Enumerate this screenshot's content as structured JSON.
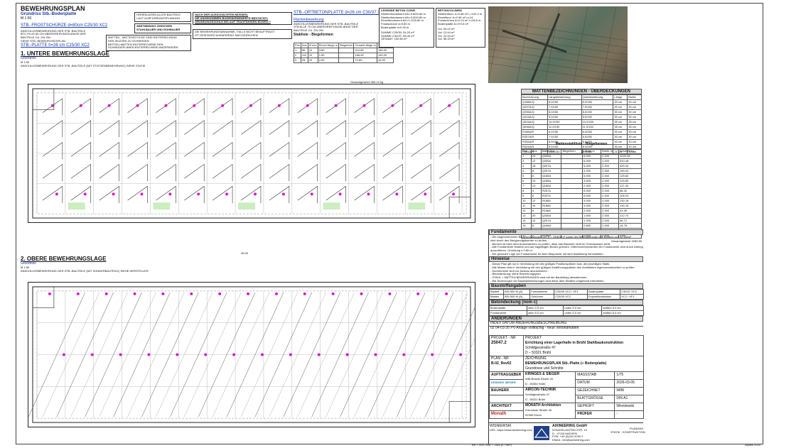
{
  "header": {
    "title": "BEWEHRUNGSPLAN",
    "subtitle": "Grundriss Stb.-Bodenplatte",
    "scale": "M 1:50",
    "frost_line": "STB.-FROSTSCHÜRZE d=80cm C25/30 XC2",
    "frost_note_1": "ANSCHLUSSBEWEHRUNG DER STB.-BAUTEILE",
    "frost_note_2": "BTC-PLUS 50 CM ÜBERGREIFUNGSLÄNGE DER",
    "frost_note_3": "BAUTEILE CA. 20x 20x",
    "frost_note_4": "SIEHE STB.-BEWEHRUNGSPLAN",
    "plate_line": "STB.-PLATTE h=26 cm C25/30 XC2"
  },
  "notes": {
    "heights_1": "HÖHENLAGEN ALLER BAUTEILE",
    "heights_2": "LAUT AUSFÜHRUNGSPLANUNG",
    "coord_1": "ABSTIMMUNG ZWISCHEN",
    "coord_2": "STAHLBAUER UND ROHBAUER",
    "mats_1": "MATTEN - MATTENSTÜCKE SIND ENTSPRECHEND",
    "mats_2": "DEN SKIZZEN ZU SCHNEIDEN",
    "mats_3": "BESTELLMATTEN ENTSPRECHEND DEN",
    "mats_4": "SCHNEIDEPLÄNEN ENTSPRECHEND ANZEPASSEN",
    "soil_1": "NACH DER AUSSCHACHTEN MÜSSEN,",
    "soil_2": "DIE ANGENOMMEN BODENKENNWERTE BESTÄTIGT,",
    "soil_3": "GRÜNDUNGSSOHLE BIS AUF TRAGFÄHIGEN BODEN !!",
    "assume_1": "DIE BEWEHRUNGSANNAHME, FALLS NICHT BEAUFTRAGT",
    "assume_2": "IST DEM BÜRO AIXINEERING NACHZURICHEN"
  },
  "ortbeton": {
    "title": "STB.-ORTBETONPLATTE d=26 cm C30/37 XC2",
    "sub_title": "Flächenbewehrung",
    "sub_1": "ANSCHLUSSBEWEHRUNG DER STB.-BAUTEILE",
    "sub_2": "STB ALLE 75 CM ÜBERGREIFUNGSLÄNGE DER",
    "sub_3": "BAUTEILE CA. 20x 20x",
    "list_title": "Stabliste - Biegeformen",
    "headers": [
      "Pos",
      "Anz",
      "Ø mm",
      "Einzel-länge m",
      "Biegeform",
      "Gesamt-länge m",
      "Gewicht kg"
    ],
    "rows": [
      [
        "1",
        "56",
        "12",
        "3.80",
        "",
        "212.80",
        "189.00"
      ],
      [
        "2",
        "112",
        "12",
        "1.50",
        "",
        "168.00",
        "149.20"
      ],
      [
        "3",
        "28",
        "10",
        "2.60",
        "",
        "72.80",
        "44.90"
      ]
    ],
    "sum_label": "Gesamtgewicht",
    "sum_value": "383.10 kg"
  },
  "legend_concrete": {
    "title": "LEGENDE BETON C25/30",
    "lines": [
      "Streifenfundament b/h=0.60/0.80 m",
      "Streifenfundament b/h=0.50/0.80 m",
      "Einzelfundament b/h=1.20/0.80 m",
      "Frostschürze d=0.80 m",
      "Bodenplatte d=0.26 m"
    ],
    "sums": [
      "SUMME C25/30: 54.20 m³",
      "SUMME C30/37: 96.40 m³",
      "GESAMT: 150.60 m³"
    ]
  },
  "legend_volume": {
    "title": "BETONVOLUMEN",
    "lines": [
      "Streifenfund. A=0.48 m² L=104.2 m",
      "Einzelfund. A=0.96 m² n=14",
      "Frostschürze A=0.24 m² L=95.6 m",
      "Bodenplatte A=370.5 m²"
    ],
    "sums": [
      "Vol. 50.02 m³",
      "Vol. 13.44 m³",
      "Vol. 22.94 m³",
      "Vol. 96.33 m³"
    ]
  },
  "plan1": {
    "title": "1. UNTERE BEWEHRUNGSLAGE",
    "sub": "Grundriss",
    "scale": "M 1:50",
    "note": "ANSCHLUSSBEWEHRUNG DER STB.-BAUTEILE (MIT STÜTZENBEWEHRUNG) SIEHE STATIK"
  },
  "plan2": {
    "title": "2. OBERE BEWEHRUNGSLAGE",
    "sub": "Grundriss",
    "scale": "M 1:50",
    "note": "ANSCHLUSSBEWEHRUNG DER STB.-BAUTEILE (MIT SONDERBAUTEILE) SIEHE HERSTELLER"
  },
  "dimension_total": "45.00",
  "mats_table": {
    "title": "MATTENBEZEICHNUNGEN - ÜBERDECKUNGEN",
    "headers": [
      "Bezeichnung",
      "Längsbewehrung",
      "Querbewehrung",
      "Länge",
      "Breite"
    ],
    "rows": [
      [
        "Q188A/Q",
        "6.0/150",
        "6.0/150",
        "30 cm",
        "30 cm"
      ],
      [
        "Q257A/Q",
        "7.0/150",
        "7.0/150",
        "30 cm",
        "30 cm"
      ],
      [
        "Q335A/Q",
        "8.0/150",
        "8.0/150",
        "30 cm",
        "30 cm"
      ],
      [
        "Q424A/Q",
        "9.0/150",
        "9.0/150",
        "30 cm",
        "30 cm"
      ],
      [
        "Q524A/Q",
        "10.0/150",
        "10.0/150",
        "35 cm",
        "35 cm"
      ],
      [
        "Q636A/Q",
        "11.0/150",
        "11.0/150",
        "35 cm",
        "35 cm"
      ],
      [
        "R188A/R",
        "6.0/150",
        "6.0/250",
        "30 cm",
        "30 cm"
      ],
      [
        "R257A/R",
        "7.0/150",
        "6.0/250",
        "30 cm",
        "30 cm"
      ],
      [
        "R335A/R",
        "8.0/150",
        "6.0/250",
        "30 cm",
        "30 cm"
      ],
      [
        "R424A/R",
        "9.0/150",
        "8.0/250",
        "30 cm",
        "30 cm"
      ],
      [
        "R524A/R",
        "10.0/150",
        "8.0/250",
        "35 cm",
        "35 cm"
      ]
    ]
  },
  "steel_table": {
    "title": "Mattenstahlliste - Biegeformen",
    "headers": [
      "Pos",
      "Anz",
      "Mattentyp",
      "Biegeform",
      "Länge m",
      "Breite m",
      "Gewicht kg"
    ],
    "rows": [
      [
        "1",
        "24",
        "Q335A",
        "",
        "6.000",
        "2.300",
        "1020.96"
      ],
      [
        "2",
        "12",
        "Q335A",
        "",
        "6.000",
        "2.300",
        "510.48"
      ],
      [
        "3",
        "18",
        "Q257A",
        "",
        "5.000",
        "2.300",
        "425.34"
      ],
      [
        "4",
        "8",
        "Q257A",
        "",
        "4.200",
        "2.300",
        "159.04"
      ],
      [
        "5",
        "6",
        "Q188A",
        "",
        "6.000",
        "2.300",
        "125.82"
      ],
      [
        "6",
        "10",
        "Q188A",
        "",
        "3.600",
        "2.300",
        "125.82"
      ],
      [
        "7",
        "14",
        "Q188A",
        "",
        "2.400",
        "2.300",
        "117.43"
      ],
      [
        "8",
        "4",
        "R257A",
        "",
        "6.000",
        "2.300",
        "86.42"
      ],
      [
        "9",
        "6",
        "R257A",
        "",
        "5.000",
        "2.300",
        "108.03"
      ],
      [
        "10",
        "12",
        "R188A",
        "",
        "4.000",
        "2.300",
        "130.18"
      ],
      [
        "11",
        "16",
        "R188A",
        "",
        "3.000",
        "2.300",
        "130.18"
      ],
      [
        "12",
        "8",
        "R188A",
        "",
        "2.000",
        "2.300",
        "43.39"
      ],
      [
        "13",
        "20",
        "Q335A",
        "",
        "1.500",
        "2.300",
        "212.70"
      ],
      [
        "14",
        "10",
        "Q257A",
        "",
        "1.200",
        "2.300",
        "56.71"
      ],
      [
        "15",
        "6",
        "Q188A",
        "",
        "0.800",
        "2.300",
        "16.78"
      ],
      [
        "16",
        "4",
        "R188A",
        "",
        "0.600",
        "2.300",
        "8.68"
      ],
      [
        "17",
        "2",
        "R188A",
        "",
        "0.400",
        "2.300",
        "2.89"
      ]
    ],
    "sum_label": "Gesamtgewicht",
    "sum_value": "3280.85"
  },
  "fundamente": {
    "title": "Fundamente",
    "lines": [
      "- Die angenommenen Bodenpressungen von σ = 150kN/m² sowie der Bettungsmodul des Bodens von 30 kN/m³",
      "  sind durch den Baugrundgutachter zu prüfen.",
      "- Bereich ist nach dem Ausschachten zu prüfen, dass das Bauwerk nicht im Grundwasser steht.",
      "- Alle Fundamente frostfrei und auf tragfähigen Boden gründen. Differenzhöhenstufen der Fundamente sind durch Abtreppungen < 30°",
      "  auszuführen. Gründung ≥ 0.80 m.",
      "- Die genauen Lage der Fundamente ist nach Absprache mit dem Bauleitung herzustellen."
    ]
  },
  "hinweise": {
    "title": "Hinweise",
    "lines": [
      "- Dieser Plan gilt nur in Verbindung mit den gültigen Positionsplänen bzw. den jeweiligen Statik.",
      "- Alle Masse sind in Verbindung mit den gültigen Ausführungsplänen des Architekten eigenverantwortlich zu prüfen.",
      "- Durchbrüche sind vor Ausbau abzustimmen.",
      "- Betondeckung: siehe Bewehrungsplan.",
      "- STAHL = MATTEN BEWEHRUNGEN sind mit der Bauleitung abzustimmen.",
      "- Bei Änderungen der Bauteilabmessungen sind diese dem Statiker umgehend mitzuteilen."
    ]
  },
  "baustoffe": {
    "title": "Baustoffangaben",
    "row1": [
      "Bauteil",
      "BSt 500 M (A)",
      "Fundamente",
      "C25/30 XC2 / XF1",
      "Bodenplatte",
      "C30/37 XC2"
    ],
    "row2": [
      "Matten",
      "BSt 500 M (A)",
      "Schürzen",
      "C25/30 XC2",
      "Expositionsklasse",
      "XC2 / XF1"
    ]
  },
  "betondeckung": {
    "title": "Betondeckung (nom c)",
    "row1": [
      "Bodenplatte",
      "oben 2.5 cm",
      "unten 5.0 cm",
      "seitlich 5.0 cm"
    ],
    "row2": [
      "Fundamente",
      "oben 5.0 cm",
      "unten 5.0 cm",
      "seitlich 5.0 cm"
    ]
  },
  "aenderungen": {
    "title": "ÄNDERUNGEN",
    "header": "INDEX  DATUM  ÄNDERUNGSBESCHREIBUNG",
    "rows": [
      {
        "index": "02",
        "date": "04-03-26",
        "text": "PV-Anlage vollflächig - neue Verbindmatten"
      }
    ]
  },
  "titleblock": {
    "project_label": "PROJEKT - NR",
    "project_nr": "25047.2",
    "project_head": "PROJEKT",
    "project_name": "Errichtung einer Lagerhalle in Brühl Stahlbaukonstruktion",
    "project_street": "Schildgesstraße 47",
    "project_city": "D – 50321 Brühl",
    "plan_label": "PLAN - NR",
    "plan_nr": "B-02_Rev02",
    "drawing_head": "ZEICHNUNG",
    "drawing_name": "BEWEHRUNGSPLAN Stb.-Platte (+ Bodenplatte)",
    "drawing_sub": "Grundrisse und Schnitte",
    "client_label": "AUFTRAGGEBER",
    "client_name": "KRINGES & SIEGER",
    "client_addr1": "Willi-Brandt-Straße 20",
    "client_addr2": "D - 50354 Hürth",
    "builder_label": "BAUHERR",
    "builder_name": "AIRCON-TECHNIK",
    "builder_addr1": "Schildgesstraße 47",
    "builder_addr2": "D - 50321 Brühl",
    "arch_label": "ARCHITEKT",
    "arch_name": "MONATH Architekten",
    "arch_addr1": "Kreuzauer Straße 46",
    "arch_addr2": "52355 Düren",
    "scale_label": "MASSSTAB",
    "scale_val": "1/75",
    "date_label": "DATUM",
    "date_val": "2026-03-05",
    "drawn_label": "GEZEICHNET",
    "drawn_val": "WIBI",
    "size_label": "BLATTGRÖSSE",
    "size_val": "DIN A1",
    "checked_label": "GEPRÜFT",
    "checked_val": "Wisniewski",
    "examiner_label": "PRÜFER",
    "examiner_val": "-",
    "logo_client": "KRINGES SIEGER",
    "logo_monath": "Monath",
    "signature_name": "WISNIEWSKI",
    "signature_sub": "URL: https://www.aixineering.com",
    "company": "AIXINEERING",
    "company_suffix": "GmbH",
    "company_addr1": "KÖNIGIN-ASTRID-STR. 19",
    "company_addr2": "D - 47119 AACHEN",
    "company_tel": "FON: +49 (0)241 8790 2",
    "company_mail": "EMAIL: info@aixineering.com",
    "company_right1": "PLANUNG ·",
    "company_right2": "STATIK · KONSTRUKTION"
  },
  "footer": {
    "left": "BH = 594 / BW = 1184 (0.70m²)",
    "right": "Allplan 2024"
  }
}
